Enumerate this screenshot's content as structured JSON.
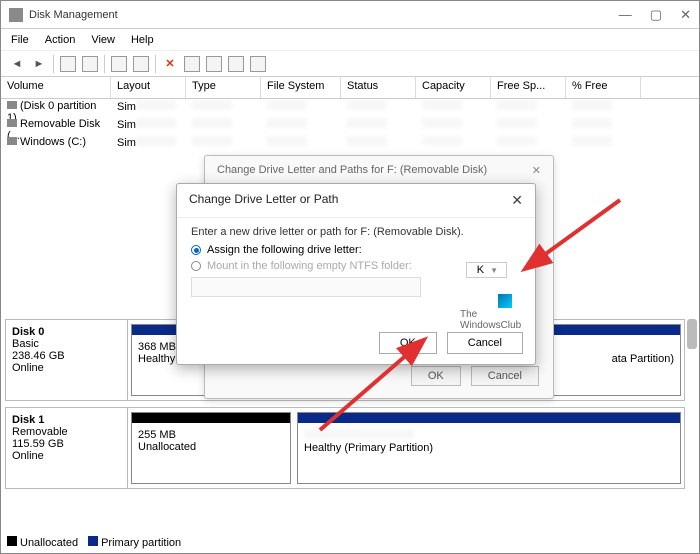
{
  "window": {
    "title": "Disk Management"
  },
  "menu": {
    "file": "File",
    "action": "Action",
    "view": "View",
    "help": "Help"
  },
  "columns": {
    "volume": "Volume",
    "layout": "Layout",
    "type": "Type",
    "fs": "File System",
    "status": "Status",
    "capacity": "Capacity",
    "freesp": "Free Sp...",
    "pctfree": "% Free"
  },
  "rows": {
    "r0": {
      "name": "(Disk 0 partition 1)",
      "layout": "Sim"
    },
    "r1": {
      "name": "Removable Disk (...",
      "layout": "Sim"
    },
    "r2": {
      "name": "Windows (C:)",
      "layout": "Sim"
    }
  },
  "disk0": {
    "name": "Disk 0",
    "type": "Basic",
    "size": "238.46 GB",
    "status": "Online",
    "p1size": "368 MB",
    "p1status": "Healthy (EFI",
    "p2tail": "ata Partition)"
  },
  "disk1": {
    "name": "Disk 1",
    "type": "Removable",
    "size": "115.59 GB",
    "status": "Online",
    "p1size": "255 MB",
    "p1status": "Unallocated",
    "p2status": "Healthy (Primary Partition)"
  },
  "legend": {
    "unalloc": "Unallocated",
    "primary": "Primary partition"
  },
  "outer_dialog": {
    "title": "Change Drive Letter and Paths for F: (Removable Disk)",
    "ok": "OK",
    "cancel": "Cancel"
  },
  "inner_dialog": {
    "title": "Change Drive Letter or Path",
    "prompt": "Enter a new drive letter or path for F: (Removable Disk).",
    "opt_assign": "Assign the following drive letter:",
    "opt_mount": "Mount in the following empty NTFS folder:",
    "letter": "K",
    "ok": "OK",
    "cancel": "Cancel"
  },
  "watermark": {
    "l1": "The",
    "l2": "WindowsClub"
  }
}
